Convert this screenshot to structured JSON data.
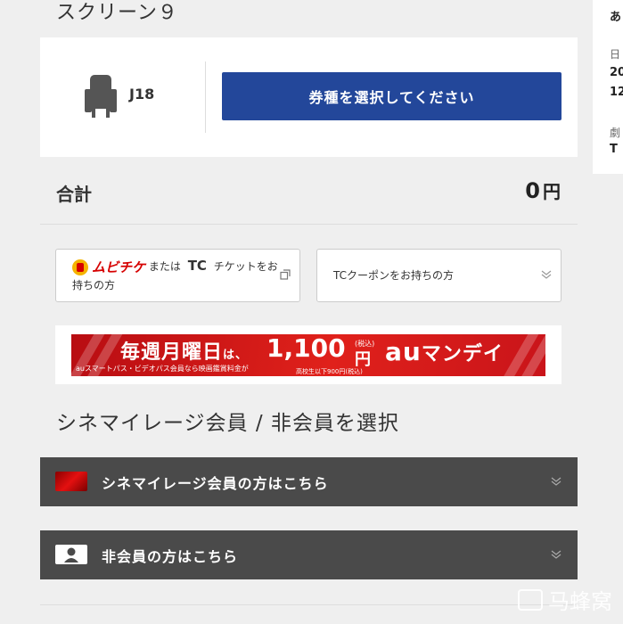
{
  "screen": {
    "title": "スクリーン９"
  },
  "side_panel": {
    "line1": "あ",
    "line2": "日",
    "line3": "20",
    "line4": "12",
    "line5": "劇",
    "line6": "T"
  },
  "seat": {
    "label": "J18",
    "select_button": "券種を選択してください"
  },
  "total": {
    "label": "合計",
    "value": "0",
    "unit": "円"
  },
  "options": {
    "mubichike_logo": "ムビチケ",
    "mubichike_text_mid": "または",
    "tc_mark": "TC",
    "mubichike_text_end": "チケットをお持ちの方",
    "tc_coupon": "TCクーポンをお持ちの方"
  },
  "banner": {
    "main": "毎週月曜日",
    "particle": "は、",
    "price": "1,100",
    "tax": "(税込)",
    "yen": "円",
    "sub": "auスマートパス・ビデオパス会員なら映画鑑賞料金が",
    "sub2": "高校生以下900円(税込)",
    "brand_au": "au",
    "brand_name": "マンデイ"
  },
  "member_section": {
    "title": "シネマイレージ会員 / 非会員を選択",
    "member_label": "シネマイレージ会員の方はこちら",
    "nonmember_label": "非会員の方はこちら"
  },
  "watermark": {
    "text": "马蜂窝"
  },
  "colors": {
    "primary_button": "#23479a",
    "accordion": "#4a4a4a",
    "banner_red": "#e0211b"
  },
  "icons": {
    "seat": "seat-icon",
    "external": "external-link-icon",
    "chevron": "chevron-down-icon",
    "card": "member-card-icon",
    "user": "user-icon"
  }
}
